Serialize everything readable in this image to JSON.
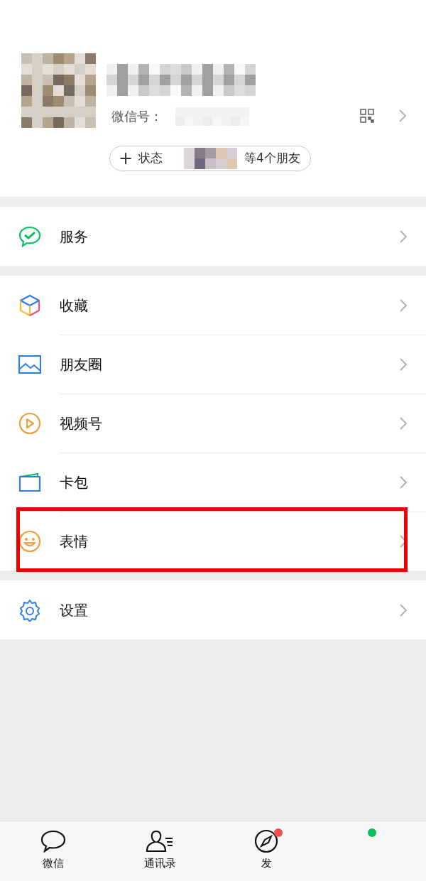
{
  "profile": {
    "id_label": "微信号：",
    "status_button": {
      "plus": "+",
      "label": "状态"
    },
    "friends_text": "等4个朋友"
  },
  "sections": [
    {
      "items": [
        {
          "kind": "service",
          "label": "服务",
          "highlighted": false
        }
      ]
    },
    {
      "items": [
        {
          "kind": "favorites",
          "label": "收藏",
          "highlighted": false
        },
        {
          "kind": "moments",
          "label": "朋友圈",
          "highlighted": false
        },
        {
          "kind": "channels",
          "label": "视频号",
          "highlighted": false
        },
        {
          "kind": "cards",
          "label": "卡包",
          "highlighted": false
        },
        {
          "kind": "stickers",
          "label": "表情",
          "highlighted": true
        }
      ]
    },
    {
      "items": [
        {
          "kind": "settings",
          "label": "设置",
          "highlighted": false
        }
      ]
    }
  ],
  "tab_bar": [
    {
      "kind": "chat",
      "label": "微信"
    },
    {
      "kind": "contacts",
      "label": "通讯录"
    },
    {
      "kind": "discover",
      "label": "发",
      "color": "#f25149"
    },
    {
      "kind": "hidden",
      "color": "#07c160"
    }
  ]
}
